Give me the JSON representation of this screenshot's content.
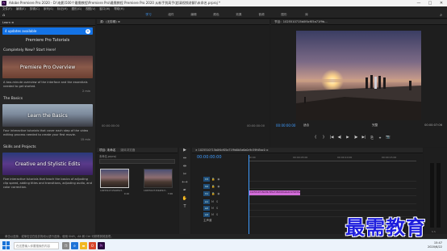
{
  "titlebar": {
    "app_icon": "Pr",
    "title": "Adobe Premiere Pro 2020 - D:\\电影\\500个最需教程\\Premiere Pro\\最需教程 Premiere Pro 2020 从新手到高手(超清视频讲解)\\未命名.prproj *",
    "buttons": [
      "—",
      "□",
      "✕"
    ]
  },
  "menubar": {
    "items": [
      "文件(F)",
      "编辑(E)",
      "剪辑(C)",
      "序列(S)",
      "标记(M)",
      "图形(G)",
      "视图(V)",
      "窗口(W)",
      "帮助(H)"
    ]
  },
  "workspace": {
    "tabs": [
      "学习",
      "组件",
      "编辑",
      "颜色",
      "效果",
      "音频",
      "图形",
      "库"
    ],
    "active": "学习"
  },
  "learn": {
    "header": "Learn ≡",
    "updates_label": "4 updates available",
    "panel_title": "Premiere Pro Tutorials",
    "sections": [
      {
        "title": "Completely New? Start Here!",
        "card_title": "Premiere Pro Overview",
        "description": "A two-minute overview of the interface and the essentials needed to get started.",
        "duration": "2 min"
      },
      {
        "title": "The Basics",
        "card_title": "Learn the Basics",
        "description": "Four interactive tutorials that cover each step of the video editing process needed to create your first movie.",
        "duration": "15 min"
      },
      {
        "title": "Skills and Projects",
        "card_title": "Creative and Stylistic Edits",
        "description": "Five interactive tutorials that teach the basics of adjusting clip speed, adding titles and transitions, adjusting audio, and color correction."
      }
    ]
  },
  "source": {
    "header": "源：(无剪辑)   ≡",
    "tc_left": "00:00:00:00",
    "tc_right": "00:00:00:00"
  },
  "program": {
    "header": "节目：1025510715b0f4cf05a71f9b...",
    "timecode": "00:00:00:00",
    "fit": "适合",
    "full": "完整",
    "tc_right": "00:00:07:06",
    "controls": [
      "{",
      "}",
      "|◀",
      "◀|",
      "▶",
      "|▶",
      "▶|",
      "⎘",
      "⌖",
      "📷"
    ]
  },
  "project": {
    "tabs": [
      "项目: 未命名",
      "媒体浏览器"
    ],
    "filename": "未命名.prproj",
    "clips": [
      {
        "name": "1025510715b0f4cf...",
        "length": "0:16"
      },
      {
        "name": "1025510715b0f4cf...",
        "length": "7:06"
      }
    ]
  },
  "tools": {
    "icons": [
      "▶",
      "⇔",
      "⇹",
      "✂",
      "⟷",
      "✒",
      "✋",
      "T"
    ]
  },
  "timeline": {
    "header": "× 1025510715b0f4cf05a71f9d0b5a6a0c9c59fd5ac0  ≡",
    "timecode": "00:00:00:00",
    "ruler": [
      "00:00",
      "00:00:05:00",
      "00:00:10:00",
      "00:00:15:00"
    ],
    "tracks": [
      "V3",
      "V2",
      "V1",
      "A1",
      "A2",
      "A3"
    ],
    "master": "主声道",
    "clip_label": "1025510715b0f4cf05a71f9d0b5a6a0c9c59fd5ac0.mp4 [V]"
  },
  "meter": {
    "label": "S S"
  },
  "statusbar": {
    "text": "单击以选择，或单击空白处并拖动以进行选择。使用 Shift、Alt 和 Ctrl 可获得其他选项。"
  },
  "taskbar": {
    "search_placeholder": "在这里输入你要搜索的内容",
    "time": "15:47",
    "date": "2020/6/22"
  },
  "watermark": "最需教育"
}
